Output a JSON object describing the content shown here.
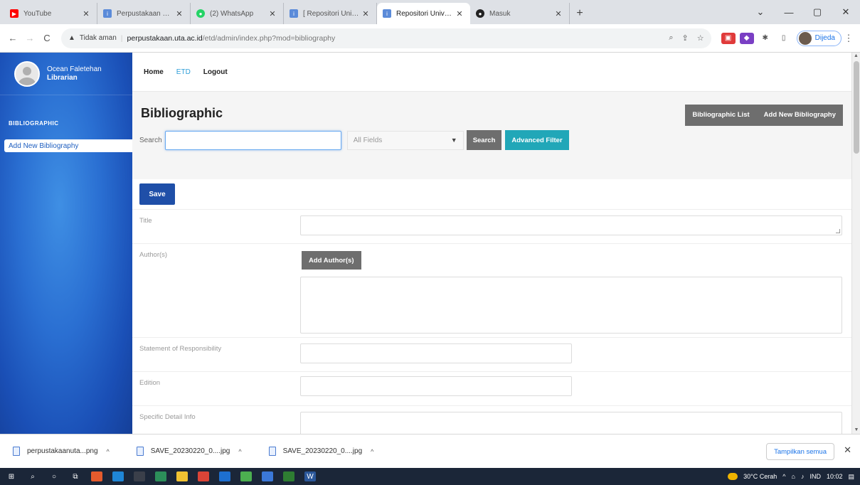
{
  "browser": {
    "tabs": [
      {
        "label": "YouTube",
        "favicon_color": "#ff0000",
        "active": false
      },
      {
        "label": "Perpustakaan Univer...",
        "favicon_color": "#5b8bd9",
        "active": false
      },
      {
        "label": "(2) WhatsApp",
        "favicon_color": "#25d366",
        "active": false
      },
      {
        "label": "[ Repositori Universi...",
        "favicon_color": "#5b8bd9",
        "active": false
      },
      {
        "label": "Repositori Universita...",
        "favicon_color": "#5b8bd9",
        "active": true
      },
      {
        "label": "Masuk",
        "favicon_color": "#222222",
        "active": false
      }
    ],
    "new_tab": "+",
    "window_controls": {
      "dropdown": "⌄",
      "minimize": "—",
      "maximize": "▢",
      "close": "✕"
    },
    "address": {
      "security": "Tidak aman",
      "host": "perpustakaan.uta.ac.id",
      "path": "/etd/admin/index.php?mod=bibliography"
    },
    "profile_label": "Dijeda"
  },
  "sidebar": {
    "user_name": "Ocean Faletehan",
    "user_role": "Librarian",
    "section": "BIBLIOGRAPHIC",
    "items": [
      {
        "label": "Add New Bibliography"
      }
    ]
  },
  "topnav": {
    "home": "Home",
    "etd": "ETD",
    "logout": "Logout"
  },
  "header": {
    "title": "Bibliographic",
    "btn_list": "Bibliographic List",
    "btn_add": "Add New Bibliography",
    "search_label": "Search",
    "search_value": "",
    "field_select": "All Fields",
    "search_button": "Search",
    "advanced_filter": "Advanced Filter"
  },
  "form": {
    "save": "Save",
    "fields": [
      {
        "label": "Title"
      },
      {
        "label": "Author(s)",
        "button": "Add Author(s)"
      },
      {
        "label": "Statement of Responsibility"
      },
      {
        "label": "Edition"
      },
      {
        "label": "Specific Detail Info"
      }
    ]
  },
  "downloads": {
    "items": [
      {
        "name": "perpustakaanuta...png"
      },
      {
        "name": "SAVE_20230220_0....jpg"
      },
      {
        "name": "SAVE_20230220_0....jpg"
      }
    ],
    "show_all": "Tampilkan semua"
  },
  "taskbar": {
    "weather": "30°C Cerah",
    "lang": "IND",
    "time": "10:02"
  }
}
